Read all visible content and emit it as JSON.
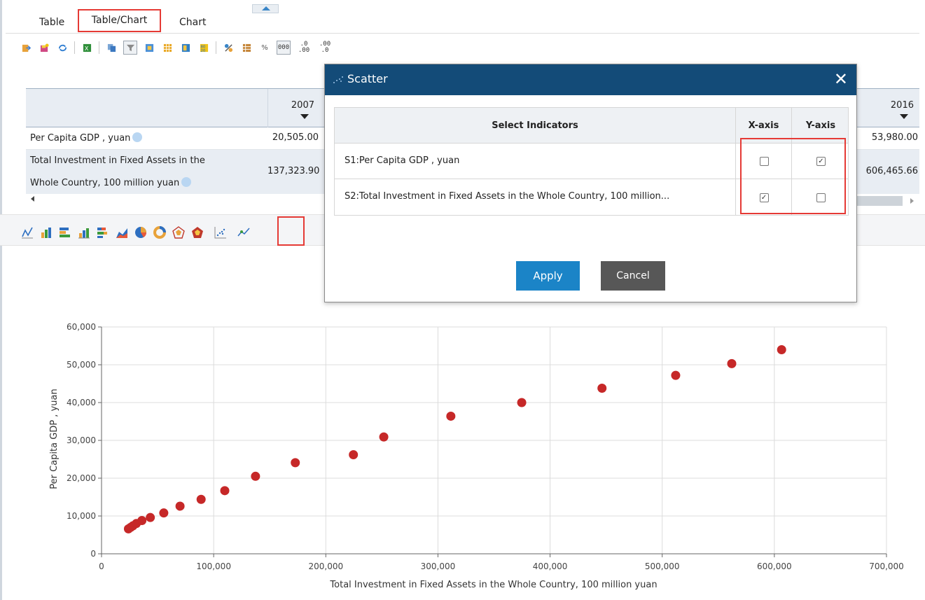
{
  "tabs": [
    {
      "label": "Table",
      "selected": false
    },
    {
      "label": "Table/Chart",
      "selected": true
    },
    {
      "label": "Chart",
      "selected": false
    }
  ],
  "toolbar": {
    "buttons": [
      "export-icon",
      "save-icon",
      "refresh-icon",
      "excel-icon",
      "copy-icon",
      "filter-icon",
      "column-icon",
      "grid-icon",
      "layout-icon",
      "number-format-icon",
      "calculate-icon",
      "table-icon"
    ],
    "percent_label": "%",
    "thousands_label": "000",
    "add_decimal_label": ".0 .00",
    "remove_decimal_label": ".00 .0"
  },
  "table": {
    "columns": {
      "first_year": "2007",
      "last_year": "2016"
    },
    "rows": [
      {
        "label": "Per Capita GDP , yuan",
        "v2007": "20,505.00",
        "v2016": "53,980.00"
      },
      {
        "label_line1": "Total Investment in Fixed Assets in the",
        "label_line2": "Whole Country, 100 million yuan",
        "v2007": "137,323.90",
        "v2016": "606,465.66"
      }
    ]
  },
  "chart_types": [
    "line-chart-icon",
    "bar-chart-icon",
    "horizontal-bar-icon",
    "stacked-bar-icon",
    "stacked-horizontal-icon",
    "area-chart-icon",
    "pie-chart-icon",
    "donut-chart-icon",
    "radar-chart-icon",
    "filled-radar-icon",
    "scatter-chart-icon",
    "bubble-chart-icon"
  ],
  "modal": {
    "title": "Scatter",
    "columns": {
      "name": "Select Indicators",
      "x": "X-axis",
      "y": "Y-axis"
    },
    "indicators": [
      {
        "name": "S1:Per Capita GDP , yuan",
        "x": false,
        "y": true
      },
      {
        "name": "S2:Total Investment in Fixed Assets in the Whole Country, 100 million...",
        "x": true,
        "y": false
      }
    ],
    "apply_label": "Apply",
    "cancel_label": "Cancel"
  },
  "chart_data": {
    "type": "scatter",
    "xlabel": "Total Investment in Fixed Assets in the Whole Country, 100 million yuan",
    "ylabel": "Per Capita GDP , yuan",
    "xlim": [
      0,
      700000
    ],
    "ylim": [
      0,
      60000
    ],
    "xticks": [
      "0",
      "100,000",
      "200,000",
      "300,000",
      "400,000",
      "500,000",
      "600,000",
      "700,000"
    ],
    "yticks": [
      "0",
      "10,000",
      "20,000",
      "30,000",
      "40,000",
      "50,000",
      "60,000"
    ],
    "grid": true,
    "color": "#c62828",
    "points": [
      [
        24000,
        6600
      ],
      [
        26000,
        7000
      ],
      [
        28000,
        7400
      ],
      [
        31000,
        8000
      ],
      [
        36000,
        8800
      ],
      [
        43500,
        9600
      ],
      [
        55500,
        10800
      ],
      [
        70000,
        12600
      ],
      [
        88800,
        14400
      ],
      [
        109900,
        16700
      ],
      [
        137300,
        20500
      ],
      [
        172800,
        24100
      ],
      [
        224600,
        26200
      ],
      [
        251700,
        30900
      ],
      [
        311500,
        36400
      ],
      [
        374700,
        40000
      ],
      [
        446300,
        43800
      ],
      [
        512000,
        47200
      ],
      [
        561999,
        50300
      ],
      [
        606466,
        53980
      ]
    ]
  }
}
